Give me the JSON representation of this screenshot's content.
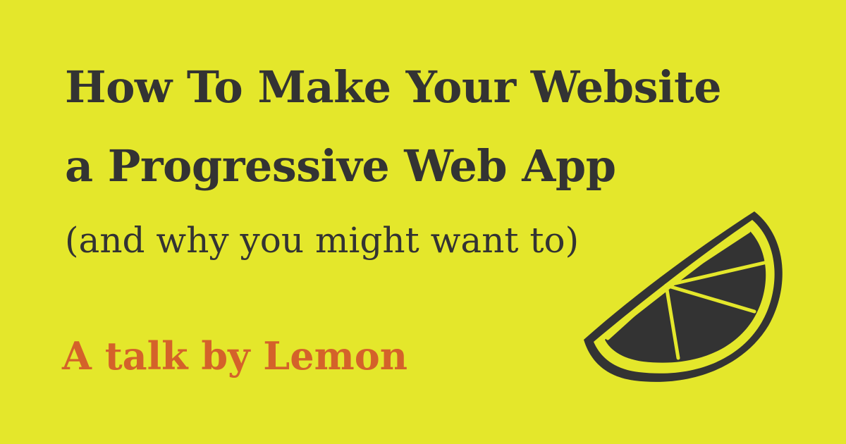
{
  "title": {
    "line1": "How To Make Your Website",
    "line2": "a Progressive Web App"
  },
  "subtitle": "(and why you might want to)",
  "byline": "A talk by Lemon",
  "colors": {
    "background": "#e4e72b",
    "text": "#333333",
    "accent": "#d4622a"
  },
  "icons": [
    "lemon-slice-icon"
  ]
}
